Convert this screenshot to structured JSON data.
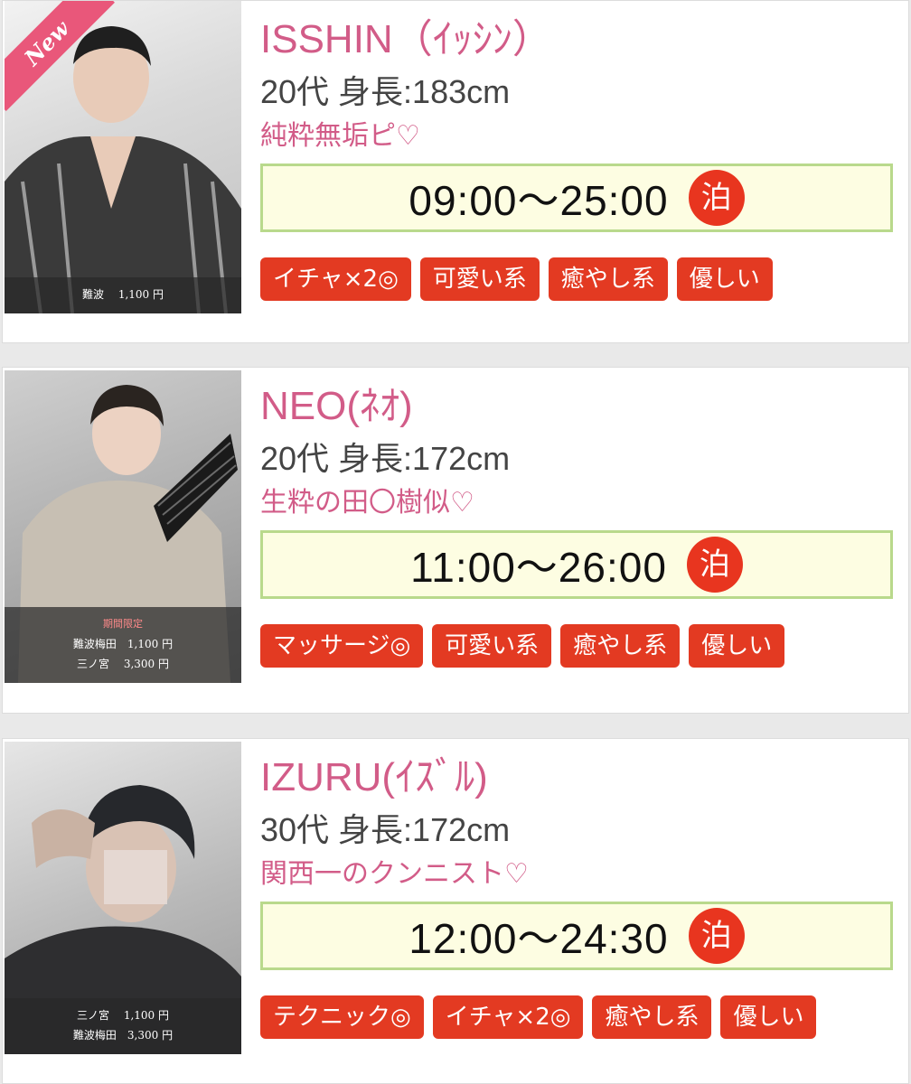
{
  "colors": {
    "name_pink": "#d25c88",
    "stay_red": "#e8351f",
    "tag_red": "#e33a22",
    "schedule_border": "#b9d98c",
    "schedule_bg": "#fdfde2"
  },
  "staff": [
    {
      "name": "ISSHIN（ｲｯｼﾝ）",
      "stats": "20代 身長:183cm",
      "catchphrase": "純粋無垢ピ♡",
      "schedule": "09:00〜25:00",
      "stay_badge": "泊",
      "badge": "New",
      "photo_overlay": [
        "難波　 1,100 円"
      ],
      "tags": [
        "イチャ×2◎",
        "可愛い系",
        "癒やし系",
        "優しい"
      ]
    },
    {
      "name": "NEO(ﾈｵ)",
      "stats": "20代 身長:172cm",
      "catchphrase": "生粋の田〇樹似♡",
      "schedule": "11:00〜26:00",
      "stay_badge": "泊",
      "photo_promo": "期間限定",
      "photo_overlay": [
        "難波梅田　1,100 円",
        "三ノ宮　 3,300 円"
      ],
      "tags": [
        "マッサージ◎",
        "可愛い系",
        "癒やし系",
        "優しい"
      ]
    },
    {
      "name": "IZURU(ｲｽﾞﾙ)",
      "stats": "30代 身長:172cm",
      "catchphrase": "関西一のクンニスト♡",
      "schedule": "12:00〜24:30",
      "stay_badge": "泊",
      "photo_overlay": [
        "三ノ宮　 1,100 円",
        "難波梅田　3,300 円"
      ],
      "tags": [
        "テクニック◎",
        "イチャ×2◎",
        "癒やし系",
        "優しい"
      ]
    }
  ]
}
